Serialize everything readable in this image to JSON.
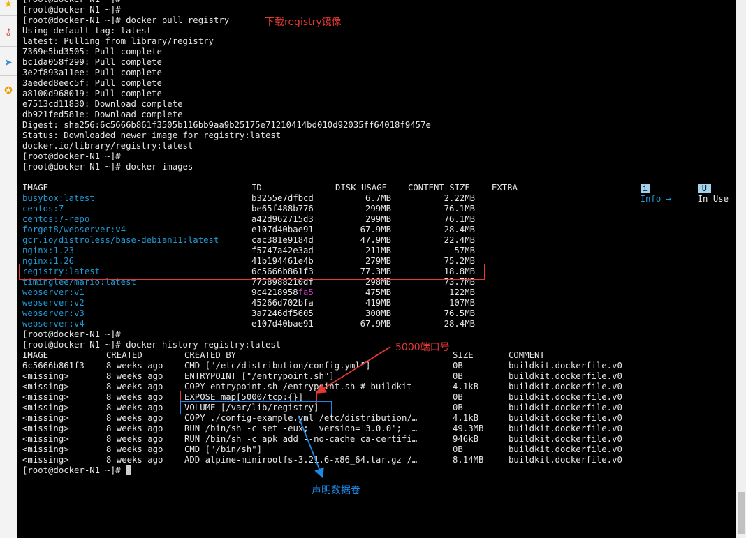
{
  "sidebar": {
    "icons": [
      "star-icon",
      "key-icon",
      "send-icon",
      "compass-icon"
    ]
  },
  "prompt": "[root@docker-N1 ~]#",
  "pull": {
    "cmd": "[root@docker-N1 ~]# docker pull registry",
    "output": [
      "Using default tag: latest",
      "latest: Pulling from library/registry",
      "7369e5bd3505: Pull complete",
      "bc1da058f299: Pull complete",
      "3e2f893a11ee: Pull complete",
      "3aeded8eec5f: Pull complete",
      "a8100d968019: Pull complete",
      "e7513cd11830: Download complete",
      "db921fed581e: Download complete",
      "Digest: sha256:6c5666b861f3505b116bb9aa9b25175e71210414bd010d92035ff64018f9457e",
      "Status: Downloaded newer image for registry:latest",
      "docker.io/library/registry:latest"
    ]
  },
  "images": {
    "cmd": "[root@docker-N1 ~]# docker images",
    "info_key": "i",
    "info_label": "Info →",
    "inuse_key": "U",
    "inuse_label": "In Use",
    "headers": {
      "image": "IMAGE",
      "id": "ID",
      "disk": "DISK USAGE",
      "content": "CONTENT SIZE",
      "extra": "EXTRA"
    },
    "rows": [
      {
        "image": "busybox:latest",
        "id": "b3255e7dfbcd",
        "disk": "6.7MB",
        "content": "2.22MB"
      },
      {
        "image": "centos:7",
        "id": "be65f488b776",
        "disk": "299MB",
        "content": "76.1MB"
      },
      {
        "image": "centos:7-repo",
        "id": "a42d962715d3",
        "disk": "299MB",
        "content": "76.1MB"
      },
      {
        "image": "forget8/webserver:v4",
        "id": "e107d40bae91",
        "disk": "67.9MB",
        "content": "28.4MB"
      },
      {
        "image": "gcr.io/distroless/base-debian11:latest",
        "id": "cac381e9184d",
        "disk": "47.9MB",
        "content": "22.4MB"
      },
      {
        "image": "nginx:1.23",
        "id": "f5747a42e3ad",
        "disk": "211MB",
        "content": "57MB"
      },
      {
        "image": "nginx:1.26",
        "id": "41b194461e4b",
        "disk": "279MB",
        "content": "75.2MB"
      },
      {
        "image": "registry:latest",
        "id": "6c5666b861f3",
        "disk": "77.3MB",
        "content": "18.8MB"
      },
      {
        "image": "timinglee/mario:latest",
        "id": "7758988210df",
        "disk": "298MB",
        "content": "73.7MB"
      },
      {
        "image": "webserver:v1",
        "id": "9c4218958",
        "id_tail": "fa5",
        "disk": "475MB",
        "content": "122MB"
      },
      {
        "image": "webserver:v2",
        "id": "45266d702bfa",
        "disk": "419MB",
        "content": "107MB"
      },
      {
        "image": "webserver:v3",
        "id": "3a7246df5605",
        "disk": "300MB",
        "content": "76.5MB"
      },
      {
        "image": "webserver:v4",
        "id": "e107d40bae91",
        "disk": "67.9MB",
        "content": "28.4MB"
      }
    ]
  },
  "history": {
    "cmd": "[root@docker-N1 ~]# docker history registry:latest",
    "headers": {
      "image": "IMAGE",
      "created": "CREATED",
      "created_by": "CREATED BY",
      "size": "SIZE",
      "comment": "COMMENT"
    },
    "rows": [
      {
        "image": "6c5666b861f3",
        "created": "8 weeks ago",
        "created_by": "CMD [\"/etc/distribution/config.yml\"]",
        "size": "0B",
        "comment": "buildkit.dockerfile.v0"
      },
      {
        "image": "<missing>",
        "created": "8 weeks ago",
        "created_by": "ENTRYPOINT [\"/entrypoint.sh\"]",
        "size": "0B",
        "comment": "buildkit.dockerfile.v0"
      },
      {
        "image": "<missing>",
        "created": "8 weeks ago",
        "created_by": "COPY entrypoint.sh /entrypoint.sh # buildkit",
        "size": "4.1kB",
        "comment": "buildkit.dockerfile.v0"
      },
      {
        "image": "<missing>",
        "created": "8 weeks ago",
        "created_by": "EXPOSE map[5000/tcp:{}]",
        "size": "0B",
        "comment": "buildkit.dockerfile.v0"
      },
      {
        "image": "<missing>",
        "created": "8 weeks ago",
        "created_by": "VOLUME [/var/lib/registry]",
        "size": "0B",
        "comment": "buildkit.dockerfile.v0"
      },
      {
        "image": "<missing>",
        "created": "8 weeks ago",
        "created_by": "COPY ./config-example.yml /etc/distribution/…",
        "size": "4.1kB",
        "comment": "buildkit.dockerfile.v0"
      },
      {
        "image": "<missing>",
        "created": "8 weeks ago",
        "created_by": "RUN /bin/sh -c set -eux;  version='3.0.0';  …",
        "size": "49.3MB",
        "comment": "buildkit.dockerfile.v0"
      },
      {
        "image": "<missing>",
        "created": "8 weeks ago",
        "created_by": "RUN /bin/sh -c apk add --no-cache ca-certifi…",
        "size": "946kB",
        "comment": "buildkit.dockerfile.v0"
      },
      {
        "image": "<missing>",
        "created": "8 weeks ago",
        "created_by": "CMD [\"/bin/sh\"]",
        "size": "0B",
        "comment": "buildkit.dockerfile.v0"
      },
      {
        "image": "<missing>",
        "created": "8 weeks ago",
        "created_by": "ADD alpine-minirootfs-3.21.6-x86_64.tar.gz /…",
        "size": "8.14MB",
        "comment": "buildkit.dockerfile.v0"
      }
    ]
  },
  "annotations": {
    "pull_note": "下载registry镜像",
    "port_note": "5000端口号",
    "volume_note": "声明数据卷",
    "red": "#e53935",
    "blue": "#1e88e5"
  }
}
